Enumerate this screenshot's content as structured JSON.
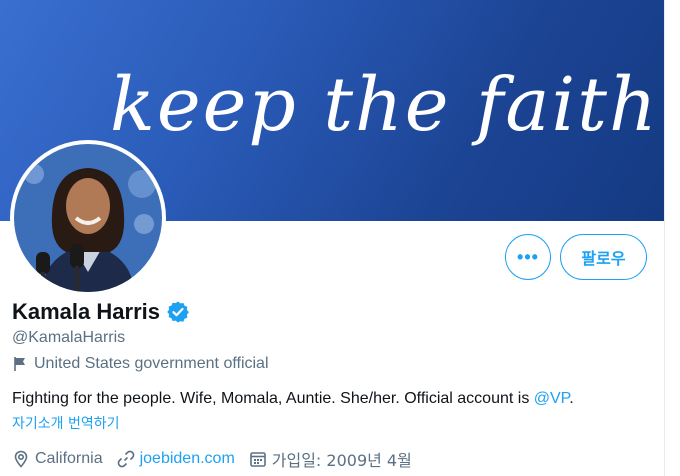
{
  "banner": {
    "script_text": "keep the faith!",
    "background_color": "#2a5bb8"
  },
  "profile": {
    "display_name": "Kamala Harris",
    "verified_icon": "verified-badge-icon",
    "handle": "@KamalaHarris",
    "account_label": "United States government official",
    "bio_text": "Fighting for the people. Wife, Momala, Auntie. She/her. Official account is ",
    "bio_mention": "@VP",
    "bio_end": ".",
    "translate_link": "자기소개 번역하기",
    "location": "California",
    "website": "joebiden.com",
    "joined": "가입일: 2009년 4월"
  },
  "actions": {
    "more_label": "•••",
    "follow_label": "팔로우"
  },
  "colors": {
    "accent": "#1da1f2",
    "secondary_text": "#5b7083",
    "primary_text": "#0f1419"
  }
}
